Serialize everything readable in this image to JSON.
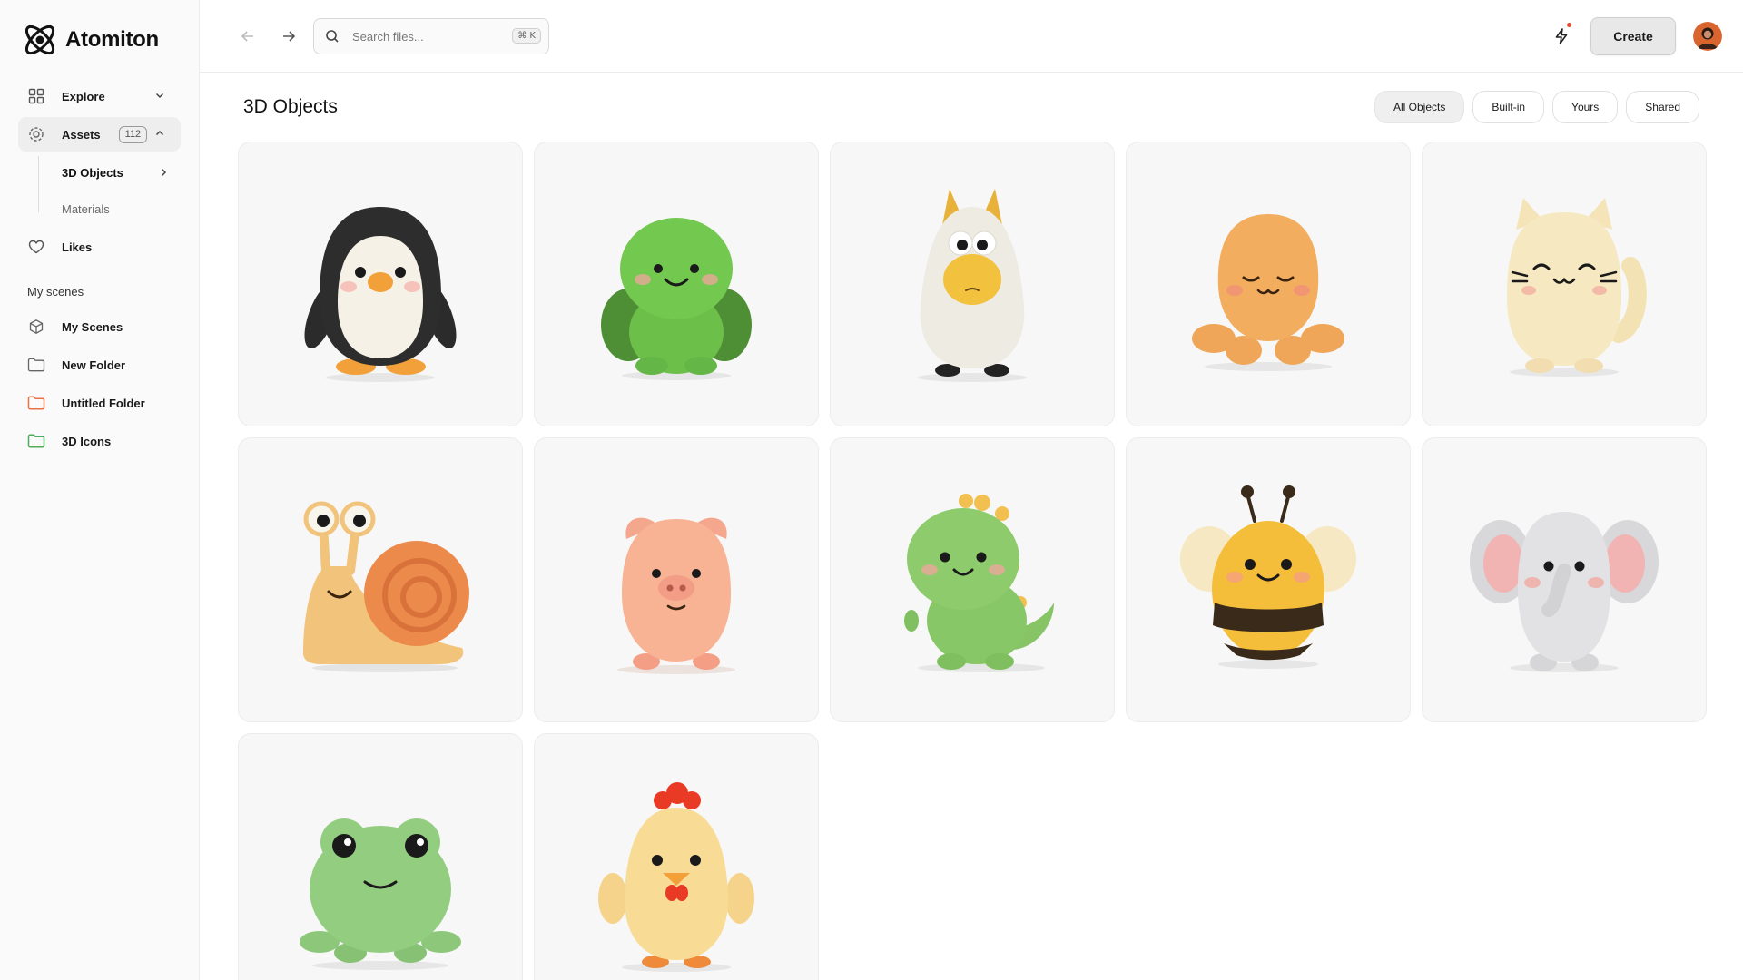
{
  "app": {
    "name": "Atomiton"
  },
  "sidebar": {
    "explore": {
      "label": "Explore",
      "icon": "grid-icon"
    },
    "assets": {
      "label": "Assets",
      "count": "112",
      "icon": "assets-icon"
    },
    "sub_items": [
      {
        "label": "3D Objects"
      },
      {
        "label": "Materials"
      }
    ],
    "likes": {
      "label": "Likes",
      "icon": "heart-icon"
    },
    "section_label": "My scenes",
    "scenes": [
      {
        "label": "My Scenes",
        "icon": "cube-icon"
      },
      {
        "label": "New Folder",
        "icon": "folder-icon"
      },
      {
        "label": "Untitled Folder",
        "icon": "folder-icon",
        "color": "#e8734a"
      },
      {
        "label": "3D Icons",
        "icon": "folder-icon",
        "color": "#4cae5a"
      }
    ]
  },
  "topbar": {
    "search_placeholder": "Search files...",
    "shortcut": "⌘ K",
    "create_label": "Create"
  },
  "main": {
    "title": "3D Objects",
    "filters": [
      "All Objects",
      "Built-in",
      "Yours",
      "Shared"
    ],
    "active_filter": "All Objects",
    "objects": [
      "penguin",
      "turtle",
      "horse",
      "octopus",
      "cat",
      "snail",
      "pig",
      "dinosaur",
      "bee",
      "elephant",
      "frog",
      "chicken"
    ]
  },
  "colors": {
    "accent_notification": "#e8472b",
    "sidebar_bg": "#fafafa",
    "card_bg": "#f7f7f7"
  }
}
